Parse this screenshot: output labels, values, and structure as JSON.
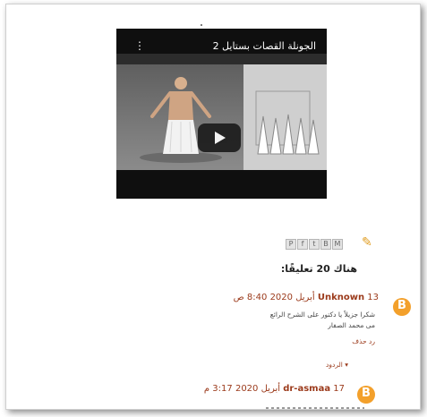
{
  "video": {
    "title": "الجونلة القصات بستايل 2",
    "more_icon": "⋮"
  },
  "comments_header": "هناك 20 تعليقًا:",
  "comments": [
    {
      "day": "13",
      "author": "Unknown",
      "date": "أبريل 2020 8:40 ص",
      "text_line1": "شكرا جزيلاً يا دكتور على الشرح الرائع",
      "text_line2": "مى محمد الصفار",
      "reply": "رد حذف",
      "replies_toggle": "الردود"
    },
    {
      "day": "17",
      "author": "dr-asmaa",
      "date": "أبريل 2020 3:17 م"
    }
  ],
  "share_icons": [
    "email-icon",
    "blogthis-icon",
    "twitter-icon",
    "facebook-icon",
    "pinterest-icon"
  ],
  "colors": {
    "link": "#9b3a1b",
    "avatar": "#f3a02b",
    "pencil": "#e09c1f"
  }
}
